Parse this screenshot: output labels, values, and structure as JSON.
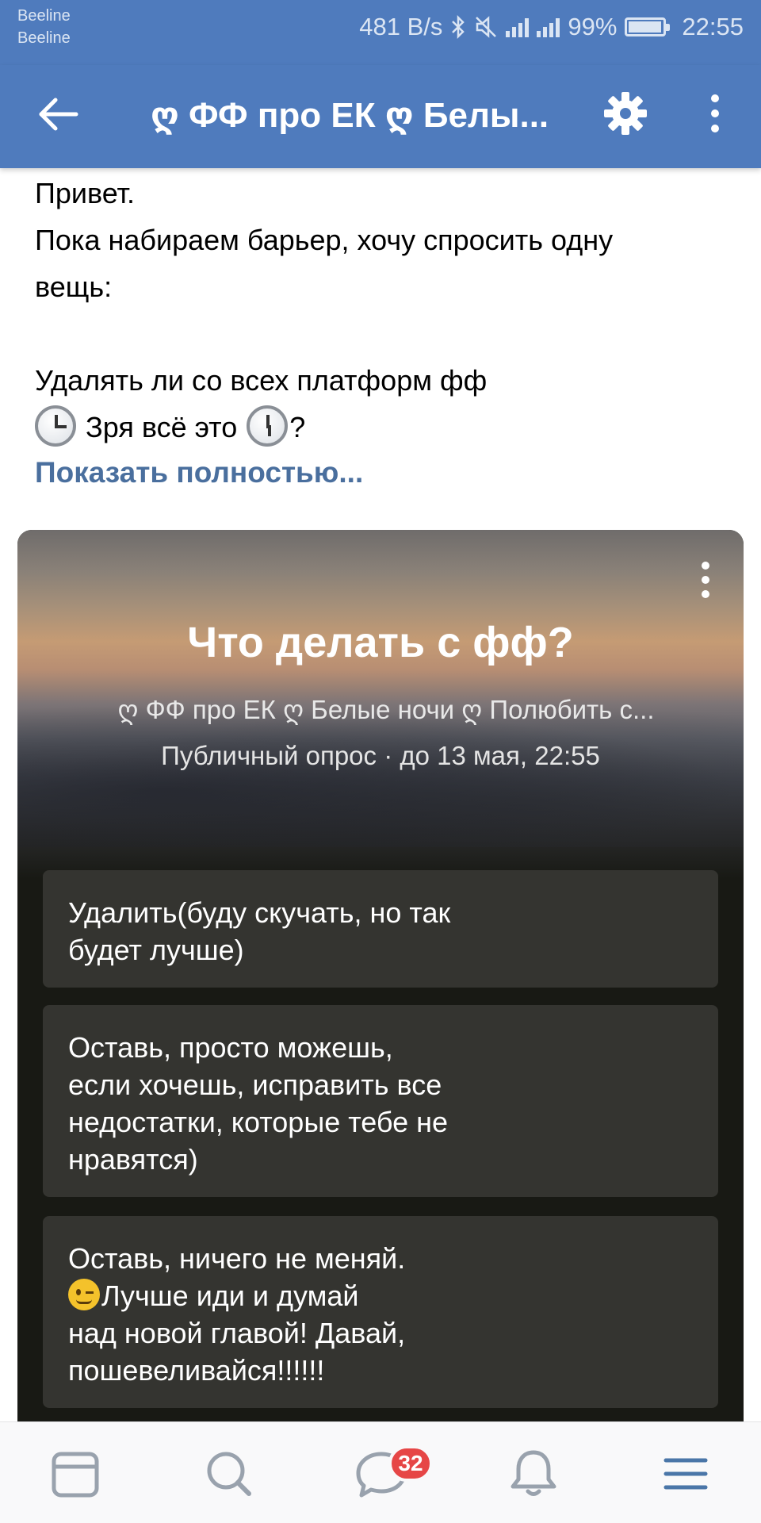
{
  "status_bar": {
    "carrier_1": "Beeline",
    "carrier_2": "Beeline",
    "net_speed": "481 B/s",
    "battery": "99%",
    "time": "22:55",
    "icons": [
      "bluetooth-icon",
      "mute-icon",
      "signal-icon",
      "4g-signal-icon",
      "battery-icon"
    ]
  },
  "app_bar": {
    "title": "ღ ФФ про ЕК ღ Белы...",
    "back_icon": "arrow-left-icon",
    "settings_icon": "gear-icon",
    "more_icon": "more-vertical-icon",
    "color": "#4f7bbd"
  },
  "post": {
    "line_1": "Привет.",
    "line_2": "Пока набираем барьер, хочу спросить одну",
    "line_3": "вещь:",
    "line_5": "Удалять ли со всех платформ фф",
    "line_6_text": "Зря всё это",
    "line_6_end": "?",
    "show_more": "Показать полностью...",
    "link_color": "#4a6f9e"
  },
  "poll": {
    "title": "Что делать с фф?",
    "source": "ღ ФФ про ЕК ღ Белые ночи ღ Полюбить с...",
    "meta": "Публичный опрос · до 13 мая, 22:55",
    "options": [
      {
        "lines": [
          "Удалить(буду скучать, но так",
          "будет лучше)"
        ]
      },
      {
        "lines": [
          "Оставь, просто можешь,",
          "если хочешь, исправить все",
          "недостатки, которые тебе не",
          "нравятся)"
        ]
      },
      {
        "lines": [
          "Лучше иди и думай",
          "над новой главой! Давай,",
          "пошевеливайся!!!!!!"
        ],
        "first_line": "Оставь, ничего не меняй."
      }
    ]
  },
  "bottom_nav": {
    "items": [
      "news-icon",
      "search-icon",
      "messages-icon",
      "notifications-icon",
      "menu-icon"
    ],
    "messages_badge": "32",
    "accent": "#4a76a8"
  }
}
